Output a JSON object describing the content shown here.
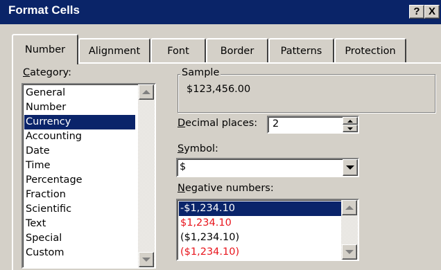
{
  "dialog": {
    "title": "Format Cells",
    "help_label": "?",
    "close_label": "X"
  },
  "tabs": [
    {
      "label": "Number",
      "active": true
    },
    {
      "label": "Alignment",
      "active": false
    },
    {
      "label": "Font",
      "active": false
    },
    {
      "label": "Border",
      "active": false
    },
    {
      "label": "Patterns",
      "active": false
    },
    {
      "label": "Protection",
      "active": false
    }
  ],
  "category": {
    "label_first": "C",
    "label_rest": "ategory:",
    "items": [
      "General",
      "Number",
      "Currency",
      "Accounting",
      "Date",
      "Time",
      "Percentage",
      "Fraction",
      "Scientific",
      "Text",
      "Special",
      "Custom"
    ],
    "selected": "Currency"
  },
  "sample": {
    "label": "Sample",
    "value": "$123,456.00"
  },
  "decimal_places": {
    "label_first": "D",
    "label_rest": "ecimal places:",
    "value": "2"
  },
  "symbol": {
    "label_first": "S",
    "label_rest": "ymbol:",
    "value": "$"
  },
  "negative_numbers": {
    "label_first": "N",
    "label_rest": "egative numbers:",
    "items": [
      {
        "text": "-$1,234.10",
        "color": "#000000",
        "selected": true
      },
      {
        "text": "$1,234.10",
        "color": "#e8141c",
        "selected": false
      },
      {
        "text": "($1,234.10)",
        "color": "#000000",
        "selected": false
      },
      {
        "text": "($1,234.10)",
        "color": "#e8141c",
        "selected": false
      }
    ]
  },
  "colors": {
    "titlebar": "#0a2468",
    "face": "#d4d0c8",
    "selection": "#0a246a",
    "negative_red": "#e8141c"
  }
}
